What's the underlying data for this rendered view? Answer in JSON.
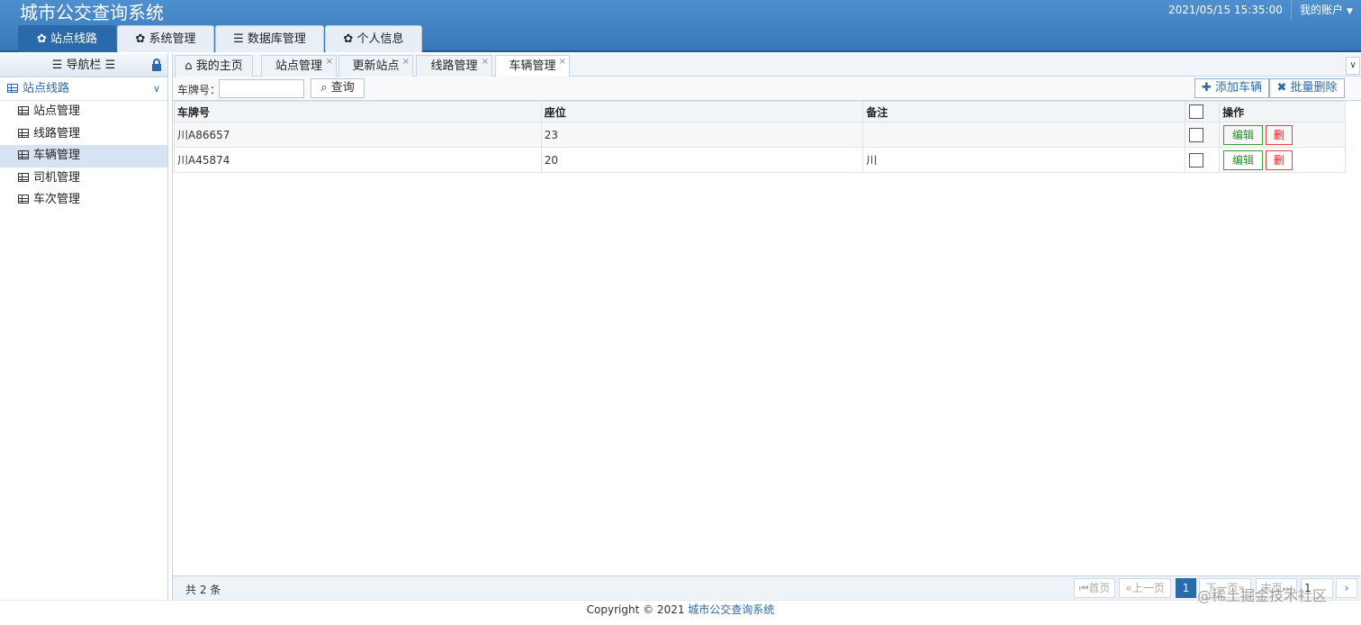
{
  "header": {
    "title": "城市公交查询系统",
    "datetime": "2021/05/15 15:35:00",
    "account": "我的账户"
  },
  "top_tabs": [
    "站点线路",
    "系统管理",
    "数据库管理",
    "个人信息"
  ],
  "nav": {
    "title": "导航栏",
    "group": "站点线路",
    "items": [
      "站点管理",
      "线路管理",
      "车辆管理",
      "司机管理",
      "车次管理"
    ],
    "active_item": "车辆管理"
  },
  "content_tabs": [
    "我的主页",
    "站点管理",
    "更新站点",
    "线路管理",
    "车辆管理"
  ],
  "toolbar": {
    "plate_label": "车牌号：",
    "plate_value": "",
    "query": "查询",
    "add": "添加车辆",
    "batch_delete": "批量删除"
  },
  "table": {
    "headers": [
      "车牌号",
      "座位",
      "备注",
      "",
      "操作"
    ],
    "rows": [
      {
        "plate": "川A86657",
        "seats": "23",
        "note": ""
      },
      {
        "plate": "川A45874",
        "seats": "20",
        "note": "川"
      }
    ],
    "edit_label": "编辑",
    "delete_label": "删"
  },
  "pager": {
    "total": "共 2 条",
    "first": "首页",
    "prev": "上一页",
    "page": "1",
    "next": "下一页",
    "last": "末页",
    "jump": "1"
  },
  "footer": {
    "copyright": "Copyright © 2021 ",
    "link": "城市公交查询系统"
  },
  "watermark": "@稀土掘金技术社区",
  "colors": {
    "header": "#3878b8",
    "active_tab": "#2a6aab",
    "edit": "#2a8a2a",
    "delete": "#dd2222"
  }
}
